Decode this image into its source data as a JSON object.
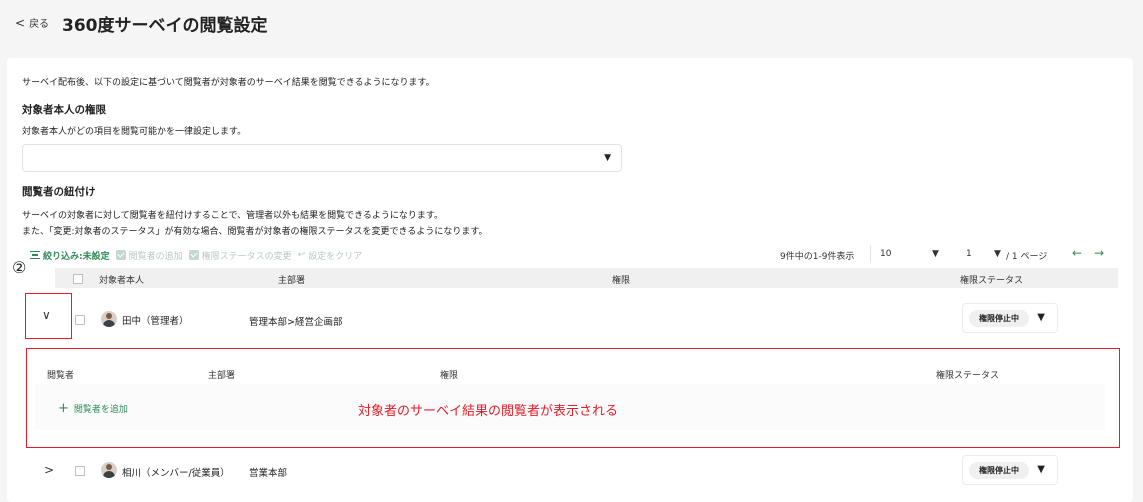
{
  "header": {
    "back_label": "戻る",
    "title": "360度サーベイの閲覧設定"
  },
  "intro": "サーベイ配布後、以下の設定に基づいて閲覧者が対象者のサーベイ結果を閲覧できるようになります。",
  "self_permission": {
    "heading": "対象者本人の権限",
    "description": "対象者本人がどの項目を閲覧可能かを一律設定します。",
    "select_value": ""
  },
  "viewer_link": {
    "heading": "閲覧者の紐付け",
    "description_1": "サーベイの対象者に対して閲覧者を紐付けすることで、管理者以外も結果を閲覧できるようになります。",
    "description_2": "また、「変更:対象者のステータス」が有効な場合、閲覧者が対象者の権限ステータスを変更できるようになります。"
  },
  "toolbar": {
    "filter_label": "絞り込み:未設定",
    "add_viewer_label": "閲覧者の追加",
    "change_status_label": "権限ステータスの変更",
    "clear_label": "設定をクリア"
  },
  "pager": {
    "summary": "9件中の1-9件表示",
    "per_page": "10",
    "page": "1",
    "total_pages": "/ 1 ページ"
  },
  "annotation_number": "②",
  "table": {
    "headers": {
      "target": "対象者本人",
      "department": "主部署",
      "permission": "権限",
      "status": "権限ステータス"
    },
    "rows": [
      {
        "name": "田中（管理者）",
        "department": "管理本部>経営企画部",
        "status": "権限停止中"
      },
      {
        "name": "相川（メンバー/従業員）",
        "department": "営業本部",
        "status": "権限停止中"
      }
    ]
  },
  "sub_table": {
    "headers": {
      "viewer": "閲覧者",
      "department": "主部署",
      "permission": "権限",
      "status": "権限ステータス"
    },
    "add_viewer_label": "閲覧者を追加",
    "annotation": "対象者のサーベイ結果の閲覧者が表示される"
  },
  "colors": {
    "accent_green": "#2e8b57",
    "annotation_red": "#e11d2a"
  }
}
